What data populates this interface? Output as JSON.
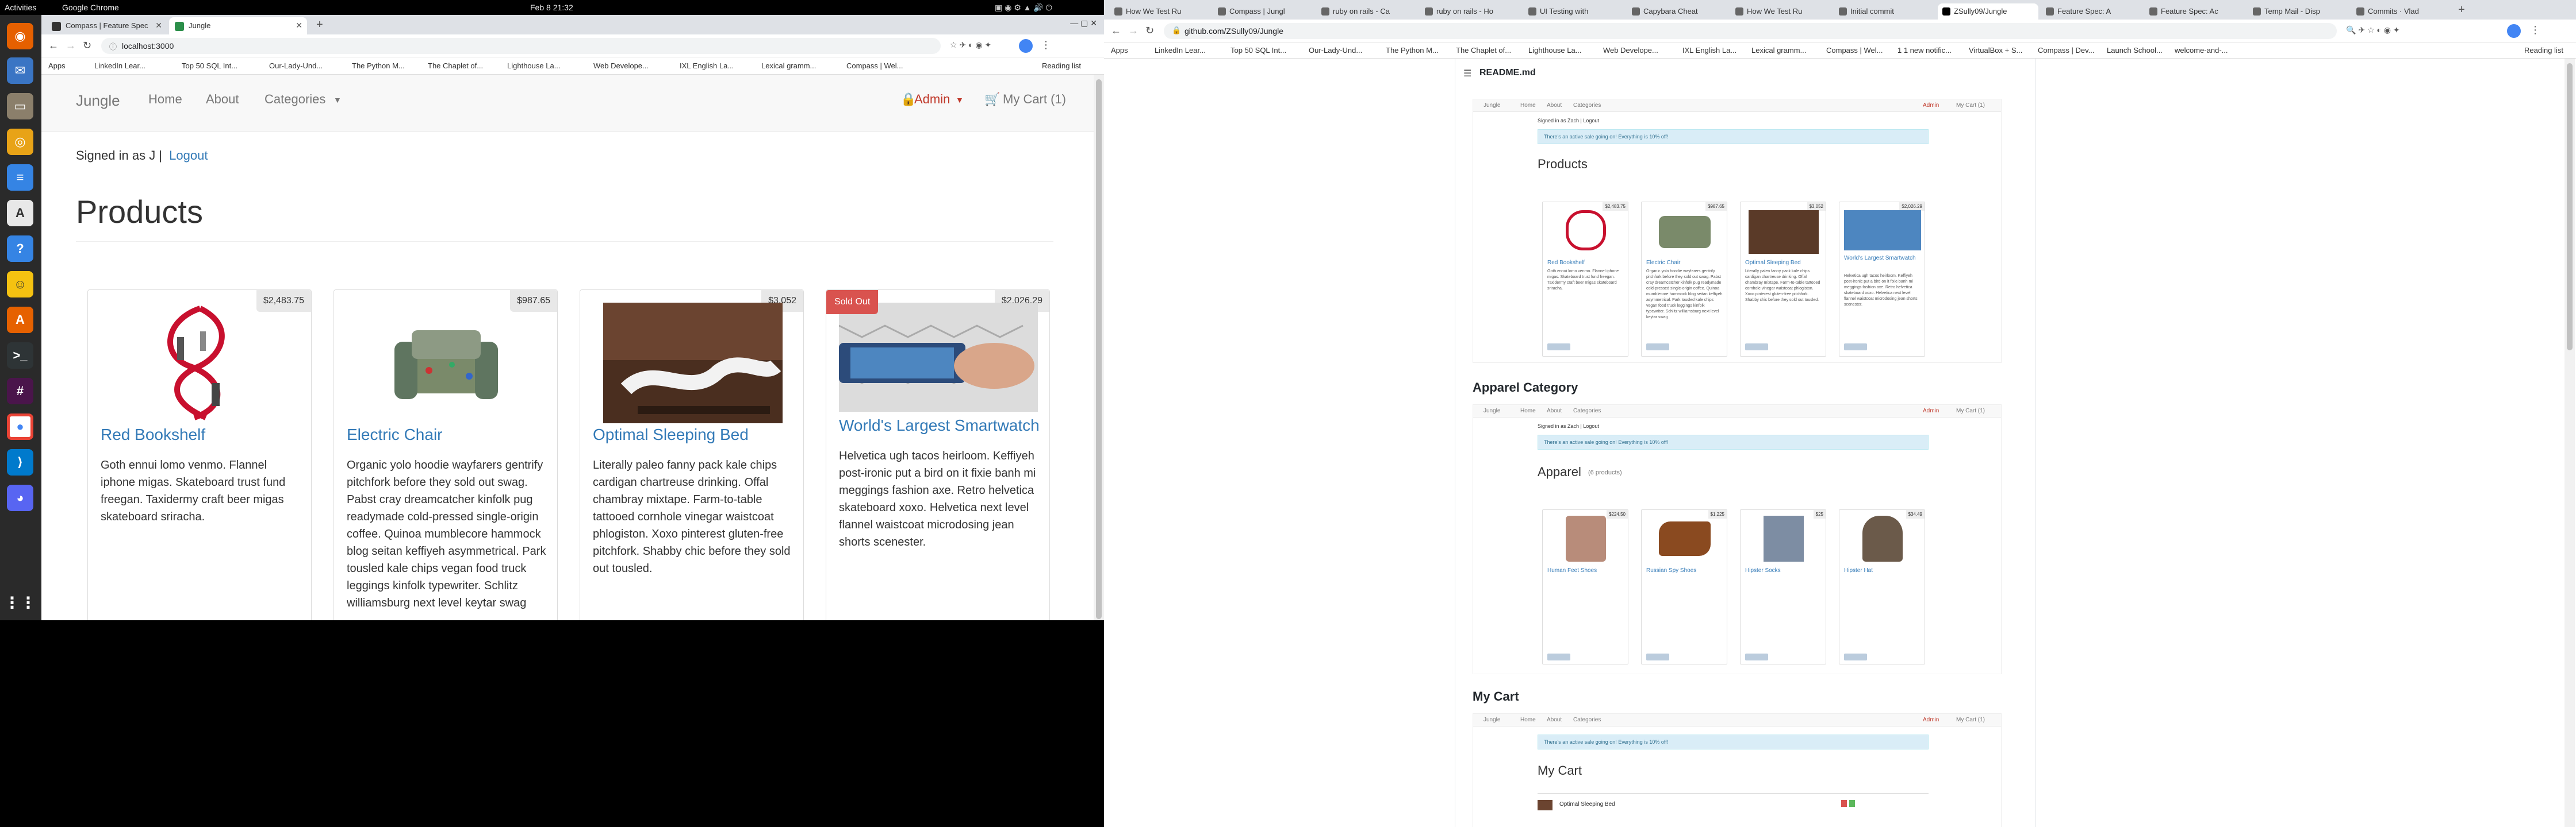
{
  "topbar": {
    "activities": "Activities",
    "app": "Google Chrome",
    "datetime": "Feb 8  21:32"
  },
  "left_browser": {
    "tabs": [
      {
        "label": "Compass | Feature Spec"
      },
      {
        "label": "Jungle"
      }
    ],
    "url": "localhost:3000",
    "bookmarks": [
      "Apps",
      "LinkedIn Lear...",
      "Top 50 SQL Int...",
      "Our-Lady-Und...",
      "The Python M...",
      "The Chaplet of...",
      "Lighthouse La...",
      "Web Develope...",
      "IXL English La...",
      "Lexical gramm...",
      "Compass | Wel..."
    ],
    "reading_list": "Reading list"
  },
  "jungle": {
    "brand": "Jungle",
    "nav": [
      "Home",
      "About",
      "Categories"
    ],
    "admin": "Admin",
    "cart": "My Cart (1)",
    "signed_in": "Signed in as J |",
    "logout": "Logout",
    "heading": "Products",
    "products": [
      {
        "name": "Red Bookshelf",
        "price": "$2,483.75",
        "sold_out": false,
        "description": "Goth ennui lomo venmo. Flannel iphone migas. Skateboard trust fund freegan. Taxidermy craft beer migas skateboard sriracha."
      },
      {
        "name": "Electric Chair",
        "price": "$987.65",
        "sold_out": false,
        "description": "Organic yolo hoodie wayfarers gentrify pitchfork before they sold out swag. Pabst cray dreamcatcher kinfolk pug readymade cold-pressed single-origin coffee. Quinoa mumblecore hammock blog seitan keffiyeh asymmetrical. Park tousled kale chips vegan food truck leggings kinfolk typewriter. Schlitz williamsburg next level keytar swag"
      },
      {
        "name": "Optimal Sleeping Bed",
        "price": "$3,052",
        "sold_out": false,
        "description": "Literally paleo fanny pack kale chips cardigan chartreuse drinking. Offal chambray mixtape. Farm-to-table tattooed cornhole vinegar waistcoat phlogiston. Xoxo pinterest gluten-free pitchfork. Shabby chic before they sold out tousled."
      },
      {
        "name": "World's Largest Smartwatch",
        "price": "$2,026.29",
        "sold_out": true,
        "sold_out_label": "Sold Out",
        "description": "Helvetica ugh tacos heirloom. Keffiyeh post-ironic put a bird on it fixie banh mi meggings fashion axe. Retro helvetica skateboard xoxo. Helvetica next level flannel waistcoat microdosing jean shorts scenester."
      }
    ]
  },
  "right_browser": {
    "tabs": [
      "How We Test Ru",
      "Compass | Jungl",
      "ruby on rails - Ca",
      "ruby on rails - Ho",
      "UI Testing with",
      "Capybara Cheat",
      "How We Test Ru",
      "Initial commit",
      "ZSully09/Jungle",
      "Feature Spec: A",
      "Feature Spec: Ac",
      "Temp Mail - Disp",
      "Commits · Vlad"
    ],
    "active_tab": 8,
    "url": "github.com/ZSully09/Jungle",
    "bookmarks": [
      "Apps",
      "LinkedIn Lear...",
      "Top 50 SQL Int...",
      "Our-Lady-Und...",
      "The Python M...",
      "The Chaplet of...",
      "Lighthouse La...",
      "Web Develope...",
      "IXL English La...",
      "Lexical gramm...",
      "Compass | Wel...",
      "1 1 new notific...",
      "VirtualBox + S...",
      "Compass | Dev...",
      "Launch School...",
      "welcome-and-..."
    ],
    "reading_list": "Reading list",
    "readme_title": "README.md",
    "sections": [
      {
        "heading": "",
        "mini_heading": "Products",
        "products": [
          {
            "name": "Red Bookshelf",
            "price": "$2,483.75"
          },
          {
            "name": "Electric Chair",
            "price": "$987.65"
          },
          {
            "name": "Optimal Sleeping Bed",
            "price": "$3,052"
          },
          {
            "name": "World's Largest Smartwatch",
            "price": "$2,026.29"
          }
        ]
      },
      {
        "heading": "Apparel Category",
        "mini_heading": "Apparel",
        "mini_sub": "(6 products)",
        "products": [
          {
            "name": "Human Feet Shoes",
            "price": "$224.50"
          },
          {
            "name": "Russian Spy Shoes",
            "price": "$1,225"
          },
          {
            "name": "Hipster Socks",
            "price": "$25"
          },
          {
            "name": "Hipster Hat",
            "price": "$34.49"
          }
        ]
      },
      {
        "heading": "My Cart",
        "mini_heading": "My Cart",
        "cart_row": "Optimal Sleeping Bed"
      }
    ],
    "mini_alert": "There's an active sale going on! Everything is 10% off!",
    "mini_signed_in": "Signed in as Zach | Logout"
  },
  "colors": {
    "link": "#337ab7",
    "sold_out": "#d9534f",
    "admin": "#c0392b"
  }
}
